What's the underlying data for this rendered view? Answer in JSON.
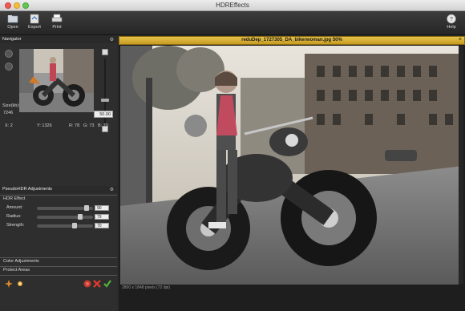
{
  "window": {
    "title": "HDREffects"
  },
  "toolbar": {
    "open": "Open",
    "export": "Export",
    "print": "Print",
    "help": "Help"
  },
  "navigator": {
    "header": "Navigator",
    "size_label": "Size(kb):",
    "size_value": "7246",
    "zoom": "50.00",
    "readout": {
      "x": "X: 2",
      "y": "Y: 1326",
      "r": "R: 78",
      "g": "G: 73",
      "b": "B: 70"
    }
  },
  "adjustments": {
    "header": "PseudoHDR Adjustments",
    "group": "HDR Effect",
    "rows": [
      {
        "name": "Amount:",
        "value": "90",
        "level": 0.9
      },
      {
        "name": "Radius:",
        "value": "79",
        "level": 0.79
      },
      {
        "name": "Strength:",
        "value": "70",
        "level": 0.7
      }
    ],
    "color_adjustments": "Color Adjustments",
    "protect_areas": "Protect Areas"
  },
  "document": {
    "title": "reduDep_1727305_DA_bikerwoman.jpg 50%",
    "status": "2800 x 1848 pixels (72 dpi)"
  },
  "icons": {
    "open": "folder-icon",
    "export": "export-icon",
    "print": "printer-icon",
    "help": "help-icon",
    "gear": "gear-icon",
    "close": "close-icon"
  },
  "colors": {
    "doc_tab": "#d7ad30",
    "panel": "#2e2e2e",
    "viewer": "#1e1e1e"
  }
}
